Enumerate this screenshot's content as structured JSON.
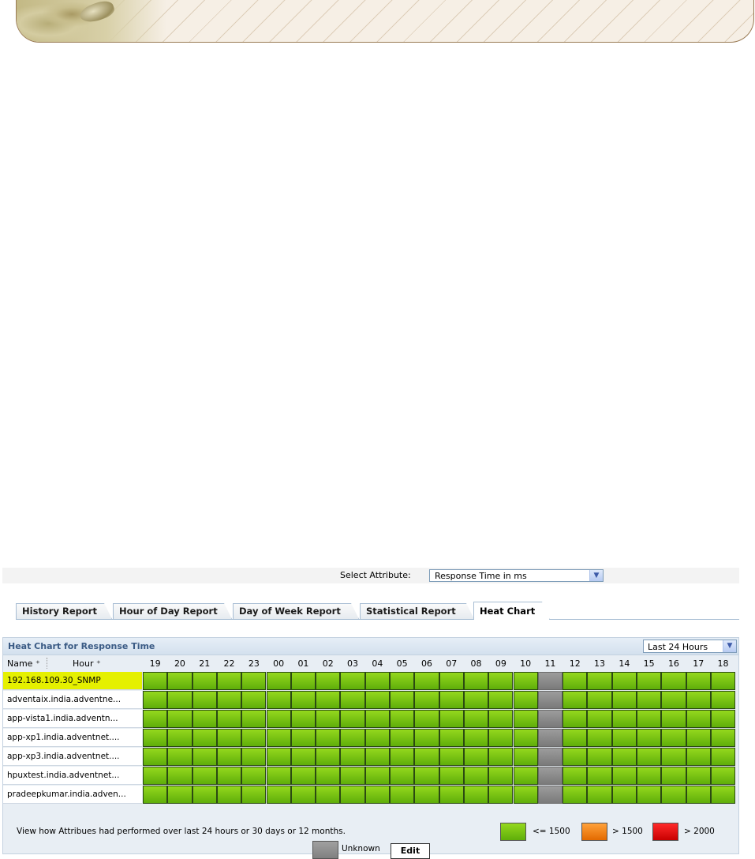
{
  "attribute": {
    "label": "Select Attribute:",
    "selected": "Response Time in ms"
  },
  "tabs": [
    {
      "label": "History Report"
    },
    {
      "label": "Hour of Day Report"
    },
    {
      "label": "Day of Week Report"
    },
    {
      "label": "Statistical Report"
    },
    {
      "label": "Heat Chart",
      "active": true
    }
  ],
  "heatchart": {
    "title": "Heat Chart for Response Time",
    "period": "Last 24 Hours",
    "header": {
      "name": "Name",
      "hour": "Hour"
    },
    "hours": [
      "19",
      "20",
      "21",
      "22",
      "23",
      "00",
      "01",
      "02",
      "03",
      "04",
      "05",
      "06",
      "07",
      "08",
      "09",
      "10",
      "11",
      "12",
      "13",
      "14",
      "15",
      "16",
      "17",
      "18"
    ],
    "unknown_hour": "11",
    "rows": [
      {
        "name": "192.168.109.30_SNMP",
        "highlighted": true
      },
      {
        "name": "adventaix.india.adventne..."
      },
      {
        "name": "app-vista1.india.adventn..."
      },
      {
        "name": "app-xp1.india.adventnet...."
      },
      {
        "name": "app-xp3.india.adventnet...."
      },
      {
        "name": "hpuxtest.india.adventnet..."
      },
      {
        "name": "pradeepkumar.india.adven..."
      }
    ],
    "footer_text": "View how Attribues had performed over last 24 hours or 30 days or 12 months.",
    "legend": {
      "green": "<= 1500",
      "orange": "> 1500",
      "red": "> 2000",
      "unknown": "Unknown"
    },
    "edit_label": "Edit"
  },
  "colors": {
    "ok": "#7ac415",
    "warning": "#f08010",
    "critical": "#e00000",
    "unknown": "#8c8c8c",
    "highlight": "#e5f000"
  }
}
